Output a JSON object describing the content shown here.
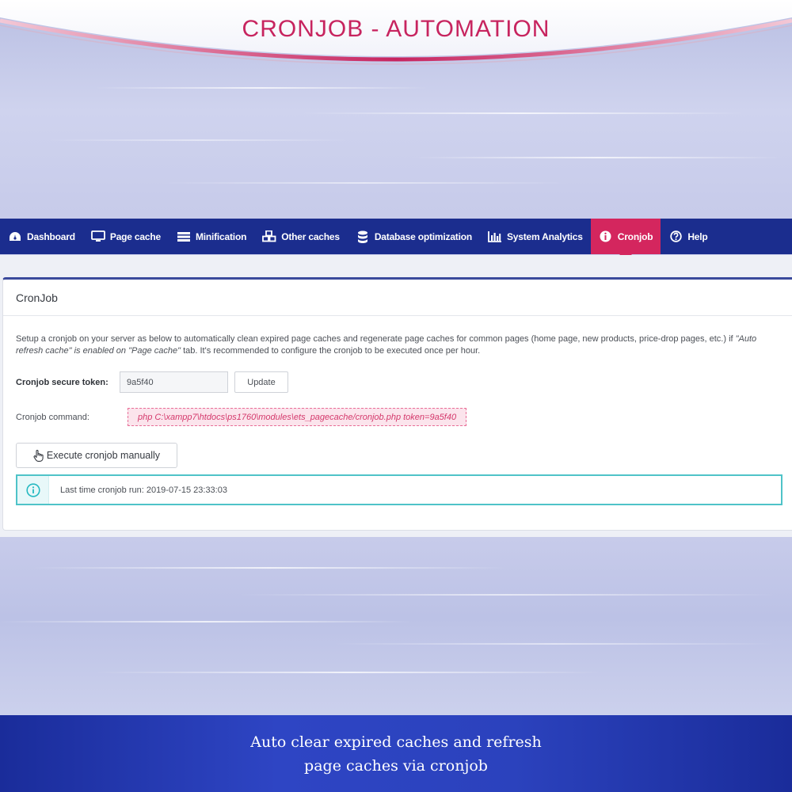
{
  "banner": {
    "title": "CRONJOB - AUTOMATION",
    "accent_color": "#c7245f"
  },
  "nav": {
    "items": [
      {
        "label": "Dashboard",
        "icon": "dashboard-icon",
        "active": false
      },
      {
        "label": "Page cache",
        "icon": "monitor-icon",
        "active": false
      },
      {
        "label": "Minification",
        "icon": "server-icon",
        "active": false
      },
      {
        "label": "Other caches",
        "icon": "cubes-icon",
        "active": false
      },
      {
        "label": "Database optimization",
        "icon": "database-icon",
        "active": false
      },
      {
        "label": "System Analytics",
        "icon": "bar-chart-icon",
        "active": false
      },
      {
        "label": "Cronjob",
        "icon": "info-circle-icon",
        "active": true
      },
      {
        "label": "Help",
        "icon": "question-circle-icon",
        "active": false
      }
    ],
    "bg_color": "#1b2d8e",
    "active_color": "#d4265e"
  },
  "panel": {
    "title": "CronJob",
    "description_part1": "Setup a cronjob on your server as below to automatically clean expired page caches and regenerate page caches for common pages (home page, new products, price-drop pages, etc.) if ",
    "description_em1": "\"Auto refresh cache\" is enabled on \"Page cache\"",
    "description_part2": " tab. It's recommended to configure the cronjob to be executed once per hour.",
    "token_label": "Cronjob secure token:",
    "token_value": "9a5f40",
    "update_label": "Update",
    "command_label": "Cronjob command:",
    "command_value": "php C:\\xampp7\\htdocs\\ps1760\\modules\\ets_pagecache/cronjob.php token=9a5f40",
    "execute_label": "Execute cronjob manually",
    "last_run_text": "Last time cronjob run: 2019-07-15 23:33:03"
  },
  "footer": {
    "line1": "Auto clear expired caches and refresh",
    "line2": "page caches via cronjob"
  }
}
